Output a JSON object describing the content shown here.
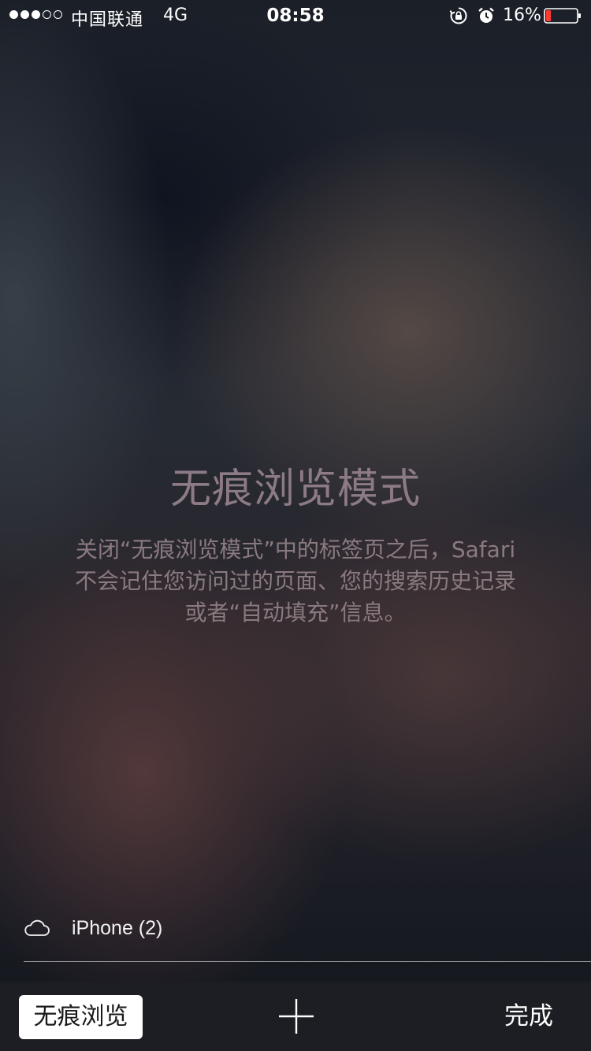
{
  "status_bar": {
    "signal_dots": [
      true,
      true,
      true,
      false,
      false
    ],
    "carrier": "中国联通",
    "network": "4G",
    "time": "08:58",
    "battery_percent": "16%",
    "battery_level": 0.16,
    "battery_color": "#ff3b30",
    "icons": [
      "rotation-lock-icon",
      "alarm-icon",
      "battery-icon"
    ]
  },
  "private_mode": {
    "title": "无痕浏览模式",
    "description_lines": [
      "关闭“无痕浏览模式”中的标签页之后，Safari",
      "不会记住您访问过的页面、您的搜索历史记录",
      "或者“自动填充”信息。"
    ]
  },
  "cloud_tabs": {
    "icon": "cloud-icon",
    "device": "iPhone (2)"
  },
  "toolbar": {
    "private_label": "无痕浏览",
    "add_icon": "plus-icon",
    "done_label": "完成"
  }
}
